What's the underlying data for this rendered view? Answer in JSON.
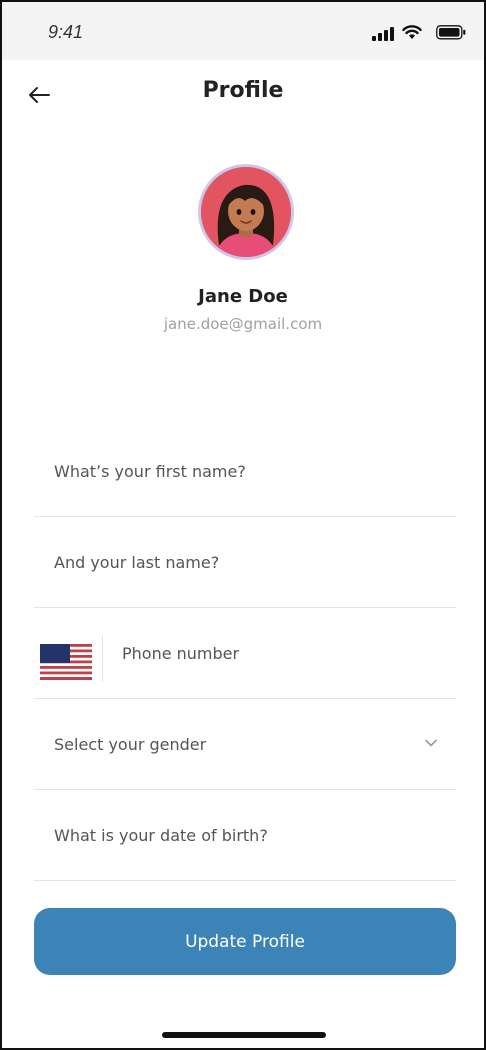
{
  "status_bar": {
    "time": "9:41",
    "icons": [
      "signal-icon",
      "wifi-icon",
      "battery-icon"
    ]
  },
  "header": {
    "title": "Profile",
    "back_icon": "arrow-left-icon"
  },
  "profile": {
    "name": "Jane Doe",
    "email": "jane.doe@gmail.com"
  },
  "form": {
    "first_name_placeholder": "What’s your first name?",
    "last_name_placeholder": "And your last name?",
    "phone_placeholder": "Phone number",
    "phone_flag_icon": "us-flag-icon",
    "gender_placeholder": "Select your gender",
    "gender_chevron_icon": "chevron-down-icon",
    "dob_placeholder": "What is your date of birth?"
  },
  "actions": {
    "update_label": "Update Profile"
  },
  "colors": {
    "primary": "#3c84b7",
    "avatar_bg": "#e25460",
    "avatar_ring": "#cfc6ec",
    "divider": "#e4e4e4",
    "muted_text": "#a0a0a0"
  }
}
